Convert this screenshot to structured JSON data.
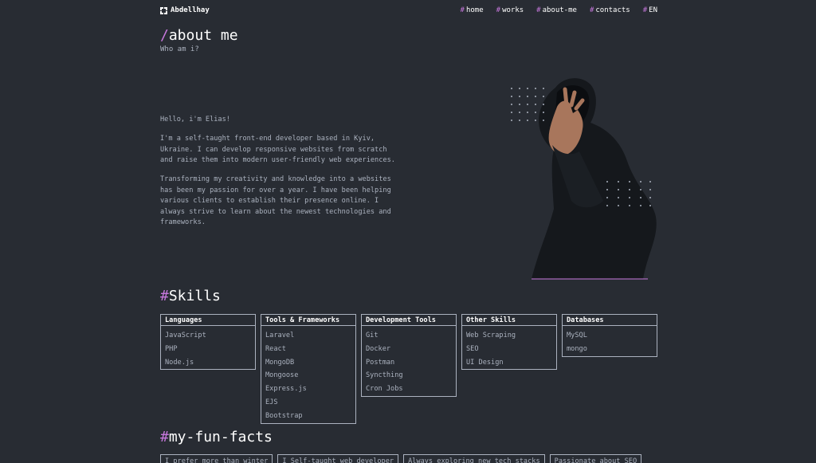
{
  "header": {
    "logo_text": "Abdellhay",
    "nav": [
      {
        "hash": "#",
        "label": "home"
      },
      {
        "hash": "#",
        "label": "works"
      },
      {
        "hash": "#",
        "label": "about-me"
      },
      {
        "hash": "#",
        "label": "contacts"
      },
      {
        "hash": "#",
        "label": "EN"
      }
    ]
  },
  "about": {
    "title_slash": "/",
    "title": "about me",
    "subtitle": "Who am i?",
    "paragraphs": [
      "Hello, i'm Elias!",
      "I'm a self-taught front-end developer based in Kyiv, Ukraine. I can develop responsive websites from scratch and raise them into modern user-friendly web experiences.",
      "Transforming my creativity and knowledge into a websites has been my passion for over a year. I have been helping various clients to establish their presence online. I always strive to learn about the newest technologies and frameworks."
    ]
  },
  "skills": {
    "title_hash": "#",
    "title": "Skills",
    "cards": [
      {
        "title": "Languages",
        "items": [
          "JavaScript",
          "PHP",
          "Node.js"
        ]
      },
      {
        "title": "Tools & Frameworks",
        "items": [
          "Laravel",
          "React",
          "MongoDB",
          "Mongoose",
          "Express.js",
          "EJS",
          "Bootstrap"
        ]
      },
      {
        "title": "Development Tools",
        "items": [
          "Git",
          "Docker",
          "Postman",
          "Syncthing",
          "Cron Jobs"
        ]
      },
      {
        "title": "Other Skills",
        "items": [
          "Web Scraping",
          "SEO",
          "UI Design"
        ]
      },
      {
        "title": "Databases",
        "items": [
          "MySQL",
          "mongo"
        ]
      }
    ]
  },
  "fun_facts": {
    "title_hash": "#",
    "title": "my-fun-facts",
    "items": [
      "I prefer more than winter",
      "I Self-taught web developer",
      "Always exploring new tech stacks",
      "Passionate about SEO"
    ]
  },
  "colors": {
    "background": "#282c33",
    "accent": "#c778dd",
    "text": "#abb2bf",
    "heading": "#ffffff"
  },
  "icons": {
    "logo": "logo-icon",
    "dots": "dot-grid-icon"
  }
}
